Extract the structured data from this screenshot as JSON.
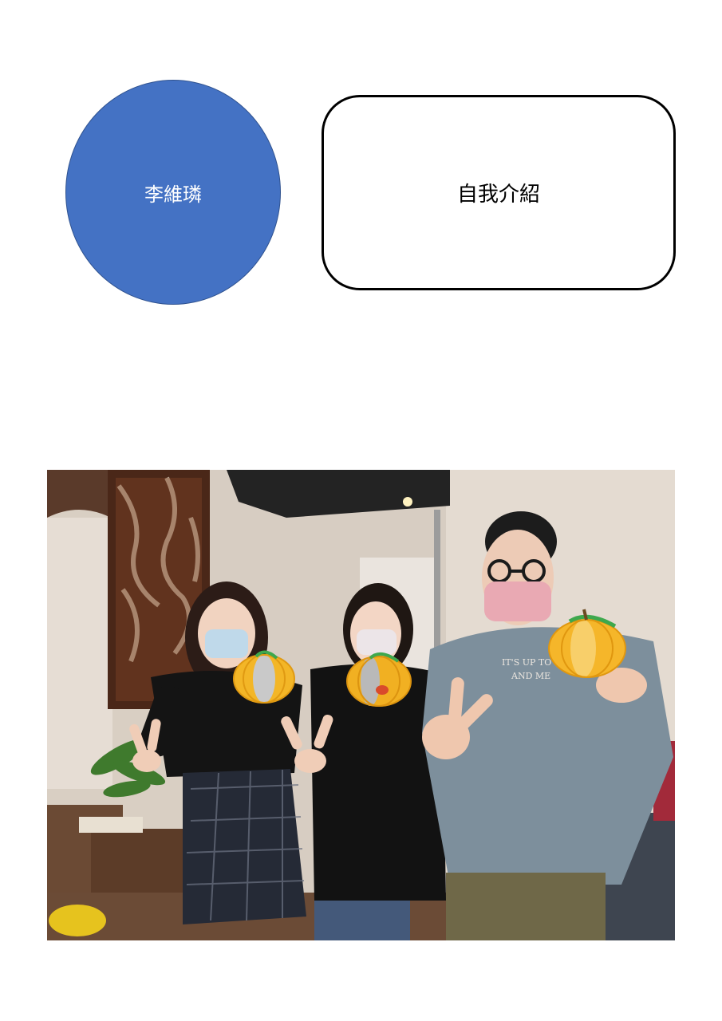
{
  "name_shape": {
    "text": "李維璘",
    "fill": "#4472c4"
  },
  "intro_box": {
    "text": "自我介紹"
  },
  "photo": {
    "sweatshirt_print": [
      "IT'S UP TO YO",
      "AND ME"
    ]
  }
}
